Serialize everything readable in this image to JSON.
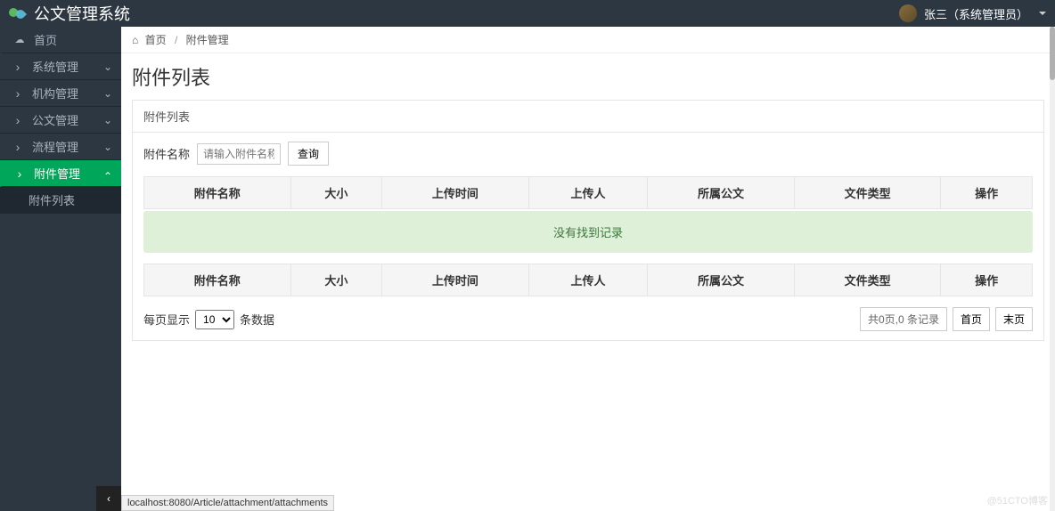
{
  "app": {
    "title": "公文管理系统",
    "user_name": "张三（系统管理员）"
  },
  "sidebar": {
    "items": [
      {
        "label": "首页",
        "icon": "dashboard"
      },
      {
        "label": "系统管理"
      },
      {
        "label": "机构管理"
      },
      {
        "label": "公文管理"
      },
      {
        "label": "流程管理"
      },
      {
        "label": "附件管理"
      },
      {
        "label": "附件列表"
      }
    ]
  },
  "breadcrumb": {
    "home": "首页",
    "current": "附件管理"
  },
  "page": {
    "title": "附件列表",
    "panel_title": "附件列表"
  },
  "search": {
    "label": "附件名称",
    "placeholder": "请输入附件名称",
    "button": "查询"
  },
  "table": {
    "columns": [
      "附件名称",
      "大小",
      "上传时间",
      "上传人",
      "所属公文",
      "文件类型",
      "操作"
    ],
    "empty": "没有找到记录"
  },
  "pager": {
    "per_page_label": "每页显示",
    "per_page_value": "10",
    "unit_label": "条数据",
    "info": "共0页,0 条记录",
    "first": "首页",
    "last": "末页"
  },
  "status": {
    "url": "localhost:8080/Article/attachment/attachments"
  },
  "watermark": "@51CTO博客"
}
